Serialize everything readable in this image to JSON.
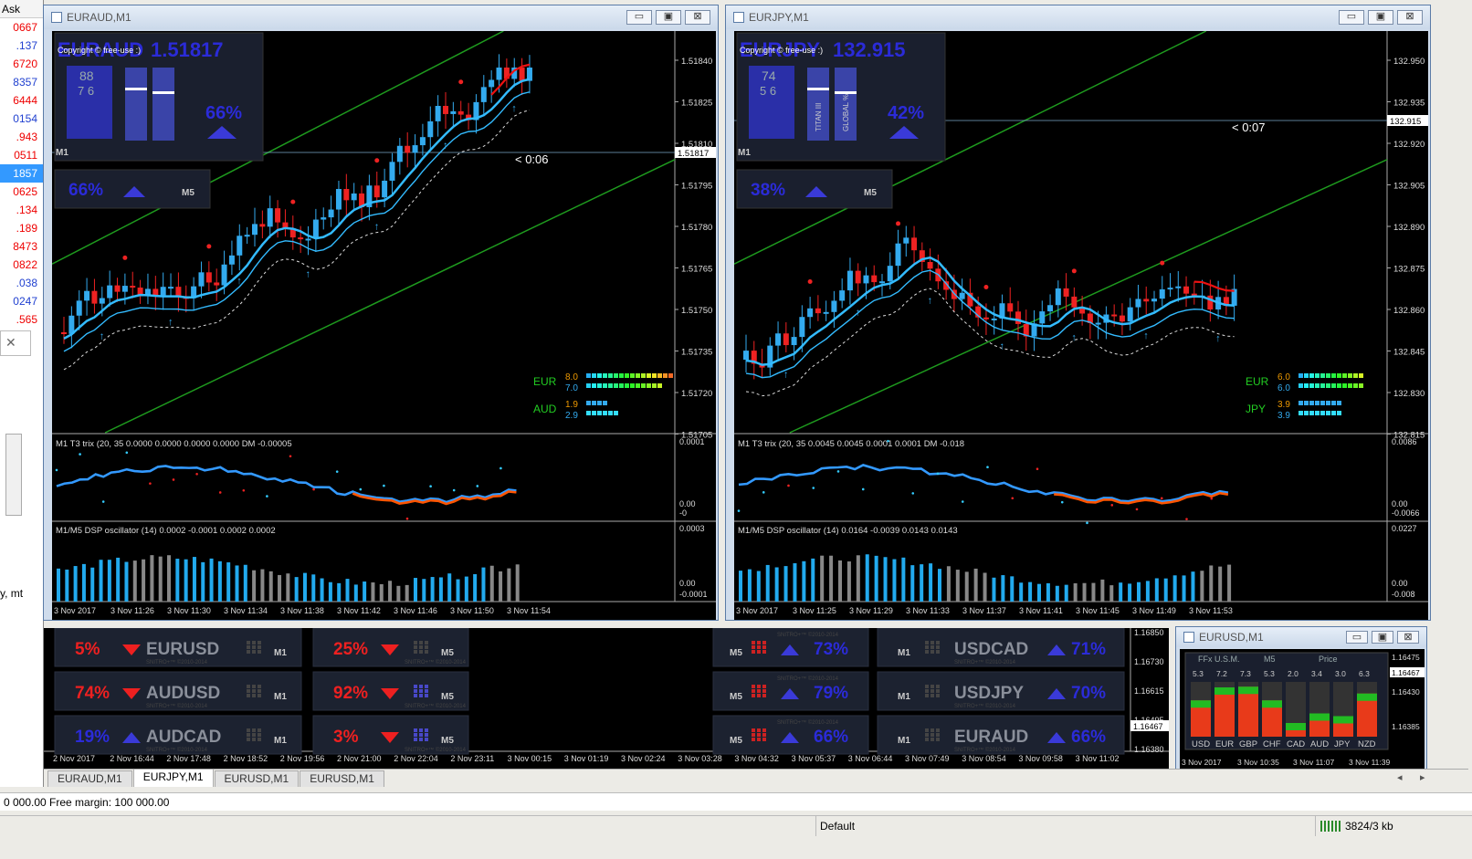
{
  "market_watch": {
    "header": "Ask",
    "rows": [
      {
        "v": "0667",
        "c": "red"
      },
      {
        "v": ".137",
        "c": "blue"
      },
      {
        "v": "6720",
        "c": "red"
      },
      {
        "v": "8357",
        "c": "blue"
      },
      {
        "v": "6444",
        "c": "red"
      },
      {
        "v": "0154",
        "c": "blue"
      },
      {
        "v": ".943",
        "c": "red"
      },
      {
        "v": "0511",
        "c": "red"
      },
      {
        "v": "1857",
        "c": "sel"
      },
      {
        "v": "0625",
        "c": "red"
      },
      {
        "v": ".134",
        "c": "red"
      },
      {
        "v": ".189",
        "c": "red"
      },
      {
        "v": "8473",
        "c": "red"
      },
      {
        "v": "0822",
        "c": "red"
      },
      {
        "v": ".038",
        "c": "blue"
      },
      {
        "v": "0247",
        "c": "blue"
      },
      {
        "v": ".565",
        "c": "red"
      }
    ],
    "fragment_text": "y, mt"
  },
  "win1": {
    "title": "EURAUD,M1",
    "btn_min": "▭",
    "btn_max": "▣",
    "btn_close": "⊠",
    "symbol": "EURAUD",
    "price": "1.51817",
    "copyright": "Copyright © free-use :)",
    "gauge_a": "88",
    "gauge_b": "7 6",
    "pct_main": "66%",
    "pct_m5": "66%",
    "tf_m1": "M1",
    "tf_m5": "M5",
    "countdown": "< 0:06",
    "price_axis": [
      "1.51840",
      "1.51825",
      "1.51810",
      "1.51795",
      "1.51780",
      "1.51765",
      "1.51750",
      "1.51735",
      "1.51720",
      "1.51705"
    ],
    "price_tag": "1.51817",
    "strength": [
      {
        "cur": "EUR",
        "v1": "8.0",
        "v2": "7.0"
      },
      {
        "cur": "AUD",
        "v1": "1.9",
        "v2": "2.9"
      }
    ],
    "trix_label": "M1 T3 trix (20, 35 0.0000 0.0000 0.0000 0.0000  DM -0.00005",
    "trix_axis": [
      "0.0001",
      "0.00",
      "-0"
    ],
    "dsp_label": "M1/M5 DSP oscillator (14) 0.0002 -0.0001 0.0002 0.0002",
    "dsp_axis": [
      "0.0003",
      "0.00",
      "-0.0001"
    ],
    "time_axis": [
      "3 Nov 2017",
      "3 Nov 11:26",
      "3 Nov 11:30",
      "3 Nov 11:34",
      "3 Nov 11:38",
      "3 Nov 11:42",
      "3 Nov 11:46",
      "3 Nov 11:50",
      "3 Nov 11:54"
    ]
  },
  "win2": {
    "title": "EURJPY,M1",
    "btn_min": "▭",
    "btn_max": "▣",
    "btn_close": "⊠",
    "symbol": "EURJPY",
    "price": "132.915",
    "copyright": "Copyright © free-use :)",
    "gauge_a": "74",
    "gauge_b": "5 6",
    "gauge_titan": "TITAN III",
    "gauge_global": "GLOBAL %",
    "pct_main": "42%",
    "pct_m5": "38%",
    "tf_m1": "M1",
    "tf_m5": "M5",
    "countdown": "< 0:07",
    "price_axis": [
      "132.950",
      "132.935",
      "132.920",
      "132.905",
      "132.890",
      "132.875",
      "132.860",
      "132.845",
      "132.830",
      "132.815"
    ],
    "price_tag": "132.915",
    "strength": [
      {
        "cur": "EUR",
        "v1": "6.0",
        "v2": "6.0"
      },
      {
        "cur": "JPY",
        "v1": "3.9",
        "v2": "3.9"
      }
    ],
    "trix_label": "M1 T3 trix (20, 35 0.0045 0.0045 0.0001 0.0001  DM -0.018",
    "trix_axis": [
      "0.0086",
      "0.00",
      "-0.0066"
    ],
    "dsp_label": "M1/M5 DSP oscillator (14) 0.0164 -0.0039 0.0143 0.0143",
    "dsp_axis": [
      "0.0227",
      "0.00",
      "-0.008"
    ],
    "time_axis": [
      "3 Nov 2017",
      "3 Nov 11:25",
      "3 Nov 11:29",
      "3 Nov 11:33",
      "3 Nov 11:37",
      "3 Nov 11:41",
      "3 Nov 11:45",
      "3 Nov 11:49",
      "3 Nov 11:53"
    ]
  },
  "panels": [
    {
      "pct": "5%",
      "dir": "down",
      "pair": "EURUSD",
      "tf": "M1"
    },
    {
      "pct": "74%",
      "dir": "down",
      "pair": "AUDUSD",
      "tf": "M1"
    },
    {
      "pct": "19%",
      "dir": "up",
      "pair": "AUDCAD",
      "tf": "M1"
    },
    {
      "pct": "25%",
      "dir": "down",
      "pair": "",
      "tf": "M5"
    },
    {
      "pct": "92%",
      "dir": "down",
      "pair": "",
      "tf": "M5"
    },
    {
      "pct": "3%",
      "dir": "down",
      "pair": "",
      "tf": "M5"
    },
    {
      "pct": "73%",
      "dir": "up",
      "pair": "",
      "tf": "M5"
    },
    {
      "pct": "79%",
      "dir": "up",
      "pair": "",
      "tf": "M5"
    },
    {
      "pct": "66%",
      "dir": "up",
      "pair": "",
      "tf": "M5"
    },
    {
      "pct": "71%",
      "dir": "up",
      "pair": "USDCAD",
      "tf": "M1"
    },
    {
      "pct": "70%",
      "dir": "up",
      "pair": "USDJPY",
      "tf": "M1"
    },
    {
      "pct": "66%",
      "dir": "up",
      "pair": "EURAUD",
      "tf": "M1"
    }
  ],
  "panel_watermark": "SNITRO+™ ©2010-2014",
  "bottom_time_axis": [
    "2 Nov 2017",
    "2 Nov 16:44",
    "2 Nov 17:48",
    "2 Nov 18:52",
    "2 Nov 19:56",
    "2 Nov 21:00",
    "2 Nov 22:04",
    "2 Nov 23:11",
    "3 Nov 00:15",
    "3 Nov 01:19",
    "3 Nov 02:24",
    "3 Nov 03:28",
    "3 Nov 04:32",
    "3 Nov 05:37",
    "3 Nov 06:44",
    "3 Nov 07:49",
    "3 Nov 08:54",
    "3 Nov 09:58",
    "3 Nov 11:02"
  ],
  "bottom_price_axis": [
    "1.16850",
    "1.16730",
    "1.16615",
    "1.16495",
    "1.16380"
  ],
  "bottom_price_tag": "1.16467",
  "win3": {
    "title": "EURUSD,M1",
    "btn_min": "▭",
    "btn_max": "▣",
    "btn_close": "⊠",
    "hdr_left": "FFx U.S.M.",
    "hdr_mid": "M5",
    "hdr_right": "Price",
    "currencies": [
      "USD",
      "EUR",
      "GBP",
      "CHF",
      "CAD",
      "AUD",
      "JPY",
      "NZD"
    ],
    "values": [
      5.3,
      7.2,
      7.3,
      5.3,
      2.0,
      3.4,
      3.0,
      6.3
    ],
    "value_labels": [
      "5.3",
      "7.2",
      "7.3",
      "5.3",
      "2.0",
      "3.4",
      "3.0",
      "6.3"
    ],
    "price_axis": [
      "1.16475",
      "1.16430",
      "1.16385"
    ],
    "price_tag": "1.16467",
    "time_axis": [
      "3 Nov 2017",
      "3 Nov 10:35",
      "3 Nov 11:07",
      "3 Nov 11:39"
    ]
  },
  "tabs": [
    "EURAUD,M1",
    "EURJPY,M1",
    "EURUSD,M1",
    "EURUSD,M1"
  ],
  "active_tab": 1,
  "status1": "0 000.00  Free margin: 100 000.00",
  "status2": {
    "profile": "Default",
    "traffic": "3824/3 kb"
  },
  "colors": {
    "bull": "#33aaee",
    "bear": "#ee2222",
    "channel": "#22aa22",
    "ma": "#33bbff",
    "ma_red": "#ee1111",
    "indigo": "#2b2bd8",
    "bg": "#000000"
  }
}
